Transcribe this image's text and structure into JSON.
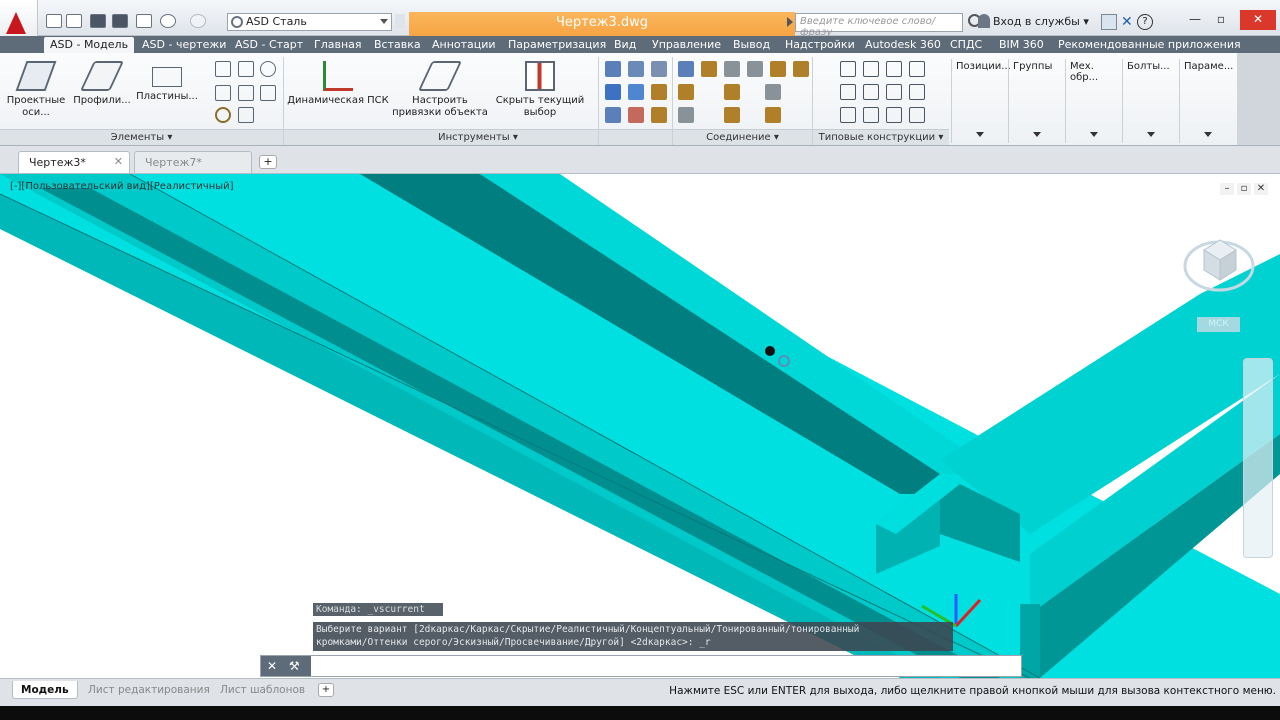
{
  "title_bar": {
    "workspace": "ASD Сталь",
    "document_title": "Чертеж3.dwg",
    "search_placeholder": "Введите ключевое слово/фразу",
    "sign_in": "Вход в службы",
    "app_icon": "autocad-logo",
    "accent_color": "#f6a443"
  },
  "ribbon_tabs": [
    "ASD - Модель",
    "ASD - чертежи",
    "ASD - Старт",
    "Главная",
    "Вставка",
    "Аннотации",
    "Параметризация",
    "Вид",
    "Управление",
    "Вывод",
    "Надстройки",
    "Autodesk 360",
    "СПДС",
    "BIM 360",
    "Рекомендованные приложения"
  ],
  "ribbon": {
    "elements": {
      "btn1": "Проектные оси...",
      "btn2": "Профили...",
      "btn3": "Пластины...",
      "footer": "Элементы"
    },
    "tools": {
      "btn1": "Динамическая ПСК",
      "btn2": "Настроить привязки объекта",
      "btn3": "Скрыть текущий выбор",
      "footer": "Инструменты"
    },
    "connections_footer": "Соединение",
    "typical_footer": "Типовые конструкции",
    "collapsed": [
      "Позиции...",
      "Группы",
      "Мех. обр...",
      "Болты...",
      "Параме..."
    ]
  },
  "file_tabs": [
    "Чертеж3*",
    "Чертеж7*"
  ],
  "viewport": {
    "label": "[-][Пользовательский вид][Реалистичный]",
    "wcs": "МСК",
    "model_color": "#00d7d8"
  },
  "command": {
    "history": "Команда: _vscurrent",
    "prompt_line1": "Выберите вариант [2dкаркас/Каркас/Скрытие/Реалистичный/Концептуальный/Тонированный/тонированный",
    "prompt_line2": "кромками/Оттенки серого/Эскизный/Просвечивание/Другой] <2dкаркас>: _r",
    "input_placeholder": ""
  },
  "layout_tabs": [
    "Модель",
    "Лист редактирования",
    "Лист шаблонов"
  ],
  "status_message": "Нажмите ESC или ENTER для выхода, либо щелкните правой кнопкой мыши для вызова контекстного меню."
}
